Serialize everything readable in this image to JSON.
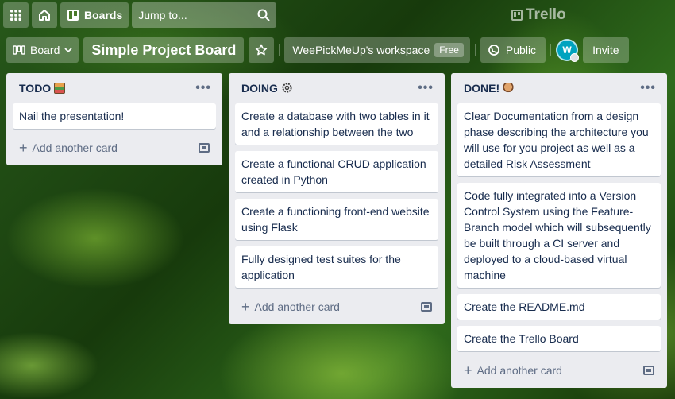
{
  "topbar": {
    "boards_label": "Boards",
    "search_placeholder": "Jump to...",
    "logo_text": "Trello"
  },
  "boardbar": {
    "view_label": "Board",
    "board_title": "Simple Project Board",
    "workspace_label": "WeePickMeUp's workspace",
    "workspace_badge": "Free",
    "visibility_label": "Public",
    "avatar_initial": "W",
    "invite_label": "Invite"
  },
  "lists": [
    {
      "title": "TODO",
      "cards": [
        "Nail the presentation!"
      ],
      "add_label": "Add another card"
    },
    {
      "title": "DOING",
      "cards": [
        "Create a database with two tables in it and a relationship between the two",
        "Create a functional CRUD application created in Python",
        "Create a functioning front-end website using Flask",
        "Fully designed test suites for the application"
      ],
      "add_label": "Add another card"
    },
    {
      "title": "DONE!",
      "cards": [
        "Clear Documentation from a design phase describing the architecture you will use for you project as well as a detailed Risk Assessment",
        "Code fully integrated into a Version Control System using the Feature-Branch model which will subsequently be built through a CI server and deployed to a cloud-based virtual machine",
        "Create the README.md",
        "Create the Trello Board"
      ],
      "add_label": "Add another card"
    }
  ],
  "colors": {
    "list_bg": "#ebecf0",
    "card_text": "#172b4d",
    "muted": "#5e6c84",
    "avatar": "#00a3bf"
  }
}
